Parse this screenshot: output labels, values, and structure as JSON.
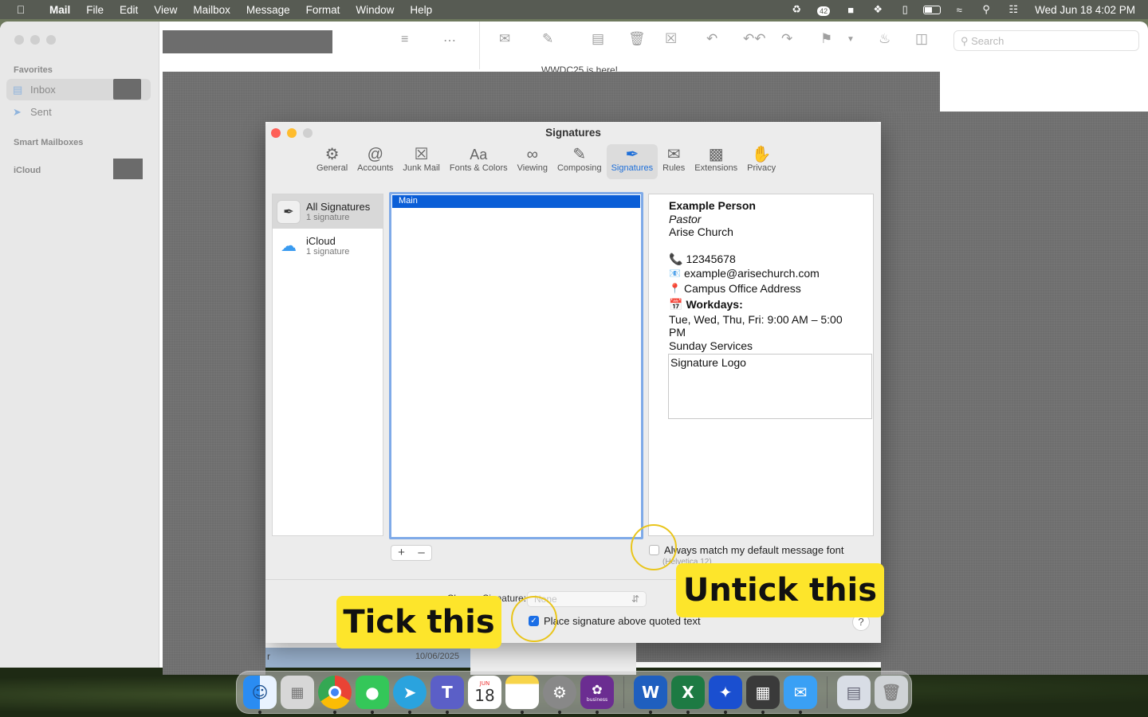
{
  "menubar": {
    "apple_icon": "apple-logo",
    "app_name": "Mail",
    "items": [
      "File",
      "Edit",
      "View",
      "Mailbox",
      "Message",
      "Format",
      "Window",
      "Help"
    ],
    "status_icons": [
      "sync-icon",
      "notification-badge-icon",
      "teams-status-icon",
      "tool-icon",
      "profile-icon",
      "battery-icon",
      "wifi-icon",
      "spotlight-icon",
      "control-center-icon"
    ],
    "badge_count": "42",
    "clock": "Wed Jun 18  4:02 PM"
  },
  "sidebar": {
    "favorites_label": "Favorites",
    "inbox_label": "Inbox",
    "sent_label": "Sent",
    "smart_label": "Smart Mailboxes",
    "icloud_label": "iCloud"
  },
  "toolbar": {
    "search_placeholder": "Search",
    "peek_text": "WWDC25 is here!"
  },
  "prefs": {
    "title": "Signatures",
    "tabs": [
      {
        "label": "General",
        "icon": "gear-icon"
      },
      {
        "label": "Accounts",
        "icon": "at-icon"
      },
      {
        "label": "Junk Mail",
        "icon": "junk-icon"
      },
      {
        "label": "Fonts & Colors",
        "icon": "fonts-icon"
      },
      {
        "label": "Viewing",
        "icon": "glasses-icon"
      },
      {
        "label": "Composing",
        "icon": "compose-icon"
      },
      {
        "label": "Signatures",
        "icon": "signature-icon"
      },
      {
        "label": "Rules",
        "icon": "rules-icon"
      },
      {
        "label": "Extensions",
        "icon": "extensions-icon"
      },
      {
        "label": "Privacy",
        "icon": "hand-icon"
      }
    ],
    "selected_tab": "Signatures",
    "accounts": [
      {
        "name": "All Signatures",
        "count": "1 signature"
      },
      {
        "name": "iCloud",
        "count": "1 signature"
      }
    ],
    "signatures": [
      "Main"
    ],
    "preview": {
      "name": "Example Person",
      "role": "Pastor",
      "org": "Arise Church",
      "phone": "12345678",
      "email": "example@arisechurch.com",
      "address": "Campus Office Address",
      "workdays_label": "Workdays:",
      "hours": "Tue, Wed, Thu, Fri: 9:00 AM – 5:00 PM",
      "services": "Sunday Services",
      "logo_text": "Signature Logo"
    },
    "add_label": "+",
    "remove_label": "–",
    "match_font_label": "Always match my default message font",
    "match_font_hint": "(Helvetica 12)",
    "match_font_checked": false,
    "choose_label": "Choose Signature:",
    "choose_value": "None",
    "place_above_label": "Place signature above quoted text",
    "place_above_checked": true,
    "help_label": "?"
  },
  "background_list": {
    "date": "10/06/2025"
  },
  "annotations": {
    "tick": "Tick this",
    "untick": "Untick this"
  },
  "dock": {
    "apps": [
      "Finder",
      "Launchpad",
      "Chrome",
      "Messages",
      "Telegram",
      "Teams",
      "Calendar",
      "Notes",
      "System Settings",
      "business",
      "Word",
      "Excel",
      "Copilot",
      "Calculator",
      "Mail",
      "Archive",
      "Trash"
    ],
    "calendar_month": "JUN",
    "calendar_day": "18",
    "business_label": "business"
  },
  "colors": {
    "accent": "#0a5ed7",
    "callout": "#fde52b"
  }
}
